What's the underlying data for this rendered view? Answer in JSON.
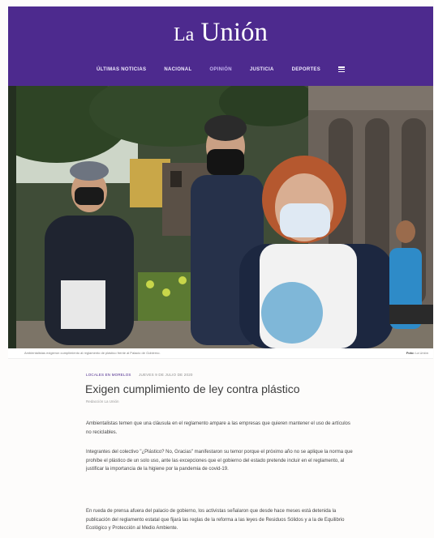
{
  "brand": {
    "logo_small": "La",
    "logo_main": "Unión"
  },
  "nav": {
    "items": [
      {
        "label": "Últimas noticias"
      },
      {
        "label": "Nacional"
      },
      {
        "label": "Opinión"
      },
      {
        "label": "Justicia"
      },
      {
        "label": "Deportes"
      }
    ]
  },
  "photo": {
    "caption": "Ambientalistas exigieron cumplimiento al reglamento de plástico frente al Palacio de Gobierno.",
    "credit_label": "Foto:",
    "credit_name": "La Unión"
  },
  "article": {
    "category": "Locales en Morelos",
    "date": "Jueves 9 de julio de 2020",
    "title": "Exigen cumplimiento de ley contra plástico",
    "byline": "Redacción La Unión",
    "paragraphs": [
      "Ambientalistas temen que una cláusula en el reglamento ampare a las empresas que quieren mantener el uso de artículos no reciclables.",
      "Integrantes del colectivo \"¿Plástico? No, Gracias\" manifestaron su temor porque el próximo año no se aplique la norma que prohíbe el plástico de un solo uso, ante las excepciones que el gobierno del estado pretende incluir en el reglamento, al justificar la importancia de la higiene por la pandemia de covid-19.",
      "En rueda de prensa afuera del palacio de gobierno, los activistas señalaron que desde hace meses está detenida la publicación del reglamento estatal que fijará las reglas de la reforma a las leyes de Residuos Sólidos y a la de Equilibrio Ecológico y Protección al Medio Ambiente."
    ]
  },
  "colors": {
    "brand": "#4d2a8e",
    "text": "#444444"
  }
}
